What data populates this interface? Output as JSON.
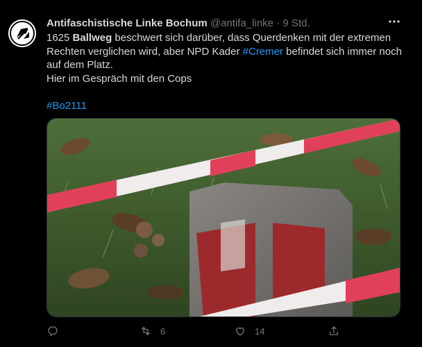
{
  "tweet": {
    "author_name": "Antifaschistische Linke Bochum",
    "author_handle": "@antifa_linke",
    "separator": "·",
    "time_ago": "9 Std.",
    "text": {
      "line1_prefix": "1625 ",
      "line1_bold": "Ballweg",
      "line1_rest": " beschwert sich darüber, dass Querdenken mit der extremen Rechten verglichen wird, aber NPD Kader ",
      "line1_hashtag": "#Cremer",
      "line1_suffix": " befindet sich immer noch auf dem Platz.",
      "line2": "Hier im Gespräch mit den Cops",
      "hashtag": "#Bo2111"
    },
    "actions": {
      "reply_count": "",
      "retweet_count": "6",
      "like_count": "14"
    }
  },
  "colors": {
    "background": "#000000",
    "text": "#d9d9d9",
    "muted": "#6e767d",
    "link": "#1d9bf0"
  },
  "icons": [
    "antifa-flag-avatar",
    "more-icon",
    "reply-icon",
    "retweet-icon",
    "like-icon",
    "share-icon"
  ]
}
